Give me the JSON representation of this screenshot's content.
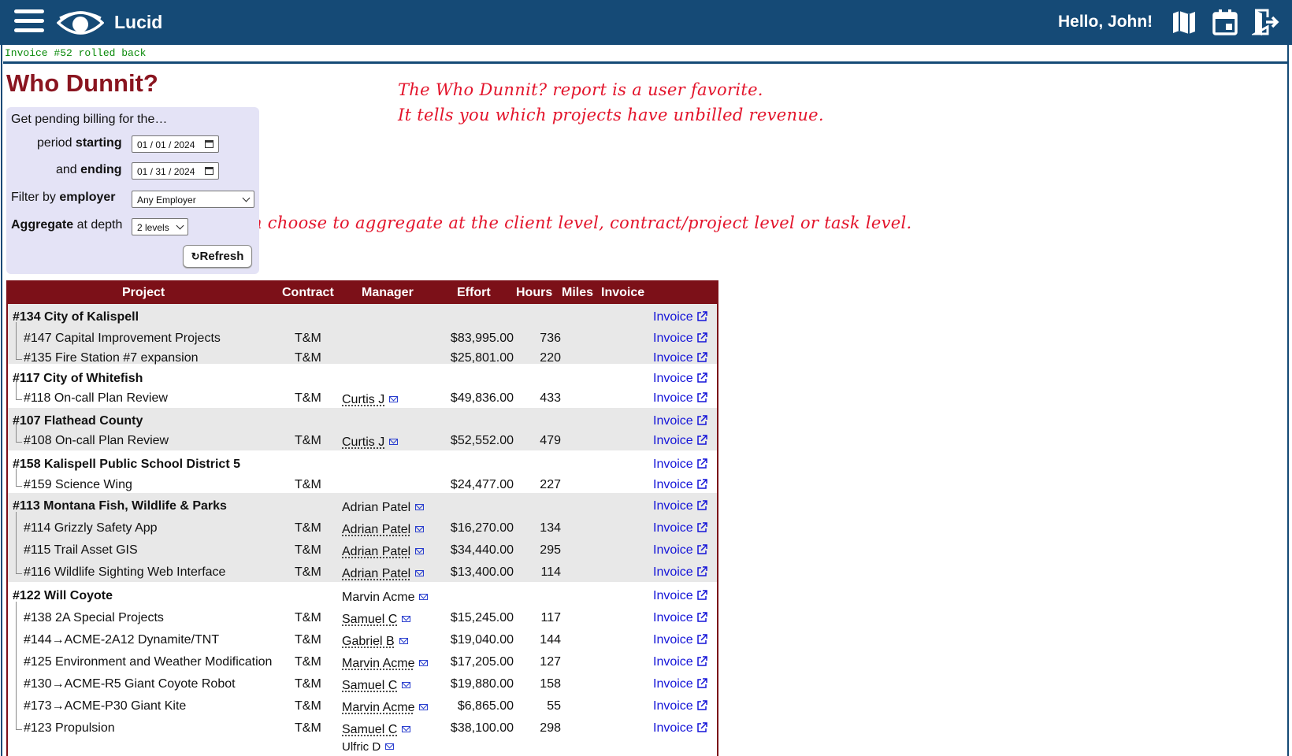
{
  "app": {
    "brand": "Lucid",
    "greeting": "Hello, John!"
  },
  "status_message": "Invoice #52 rolled back",
  "page_title": "Who Dunnit?",
  "notes": {
    "line1": "The Who Dunnit? report is a user favorite.",
    "line2": "It tells you which projects have unbilled revenue.",
    "aggregate": "You can choose to aggregate at the client level, contract/project level or task level."
  },
  "filters": {
    "intro": "Get pending billing for the…",
    "period_prefix": "period ",
    "period_bold": "starting",
    "period_start": "01 / 01 / 2024",
    "ending_prefix": "and ",
    "ending_bold": "ending",
    "period_end": "01 / 31 / 2024",
    "filter_prefix": "Filter by ",
    "filter_bold": "employer",
    "employer_selected": "Any Employer",
    "aggregate_bold": "Aggregate",
    "aggregate_suffix": " at depth",
    "depth_selected": "2 levels",
    "refresh_label": "Refresh"
  },
  "table": {
    "headers": [
      "Project",
      "Contract",
      "Manager",
      "Effort",
      "Hours",
      "Miles",
      "Invoice"
    ],
    "invoice_label": "Invoice",
    "rows": [
      {
        "project": "#134 City of Kalispell",
        "top": true
      },
      {
        "project": "#147 Capital Improvement Projects",
        "contract": "T&M",
        "effort": "$83,995.00",
        "hours": "736"
      },
      {
        "project": "#135 Fire Station #7 expansion",
        "contract": "T&M",
        "effort": "$25,801.00",
        "hours": "220"
      },
      {
        "project": "#117 City of Whitefish",
        "top": true
      },
      {
        "project": "#118 On-call Plan Review",
        "contract": "T&M",
        "manager": "Curtis J",
        "effort": "$49,836.00",
        "hours": "433"
      },
      {
        "project": "#107 Flathead County",
        "top": true
      },
      {
        "project": "#108 On-call Plan Review",
        "contract": "T&M",
        "manager": "Curtis J",
        "effort": "$52,552.00",
        "hours": "479"
      },
      {
        "project": "#158 Kalispell Public School District 5",
        "top": true
      },
      {
        "project": "#159 Science Wing",
        "contract": "T&M",
        "effort": "$24,477.00",
        "hours": "227"
      },
      {
        "project": "#113 Montana Fish, Wildlife & Parks",
        "top": true,
        "manager": "Adrian Patel"
      },
      {
        "project": "#114 Grizzly Safety App",
        "contract": "T&M",
        "manager": "Adrian Patel",
        "effort": "$16,270.00",
        "hours": "134"
      },
      {
        "project": "#115 Trail Asset GIS",
        "contract": "T&M",
        "manager": "Adrian Patel",
        "effort": "$34,440.00",
        "hours": "295"
      },
      {
        "project": "#116 Wildlife Sighting Web Interface",
        "contract": "T&M",
        "manager": "Adrian Patel",
        "effort": "$13,400.00",
        "hours": "114"
      },
      {
        "project": "#122 Will Coyote",
        "top": true,
        "manager": "Marvin Acme"
      },
      {
        "project": "#138 2A Special Projects",
        "contract": "T&M",
        "manager": "Samuel C",
        "effort": "$15,245.00",
        "hours": "117"
      },
      {
        "project": "#144→ACME-2A12 Dynamite/TNT",
        "contract": "T&M",
        "manager": "Gabriel B",
        "effort": "$19,040.00",
        "hours": "144"
      },
      {
        "project": "#125 Environment and Weather Modification",
        "contract": "T&M",
        "manager": "Marvin Acme",
        "effort": "$17,205.00",
        "hours": "127"
      },
      {
        "project": "#130→ACME-R5 Giant Coyote Robot",
        "contract": "T&M",
        "manager": "Samuel C",
        "effort": "$19,880.00",
        "hours": "158"
      },
      {
        "project": "#173→ACME-P30 Giant Kite",
        "contract": "T&M",
        "manager": "Marvin Acme",
        "effort": "$6,865.00",
        "hours": "55"
      },
      {
        "project": "#123 Propulsion",
        "contract": "T&M",
        "manager": "Samuel C",
        "manager2": "Ulfric D",
        "effort": "$38,100.00",
        "hours": "298"
      }
    ]
  }
}
